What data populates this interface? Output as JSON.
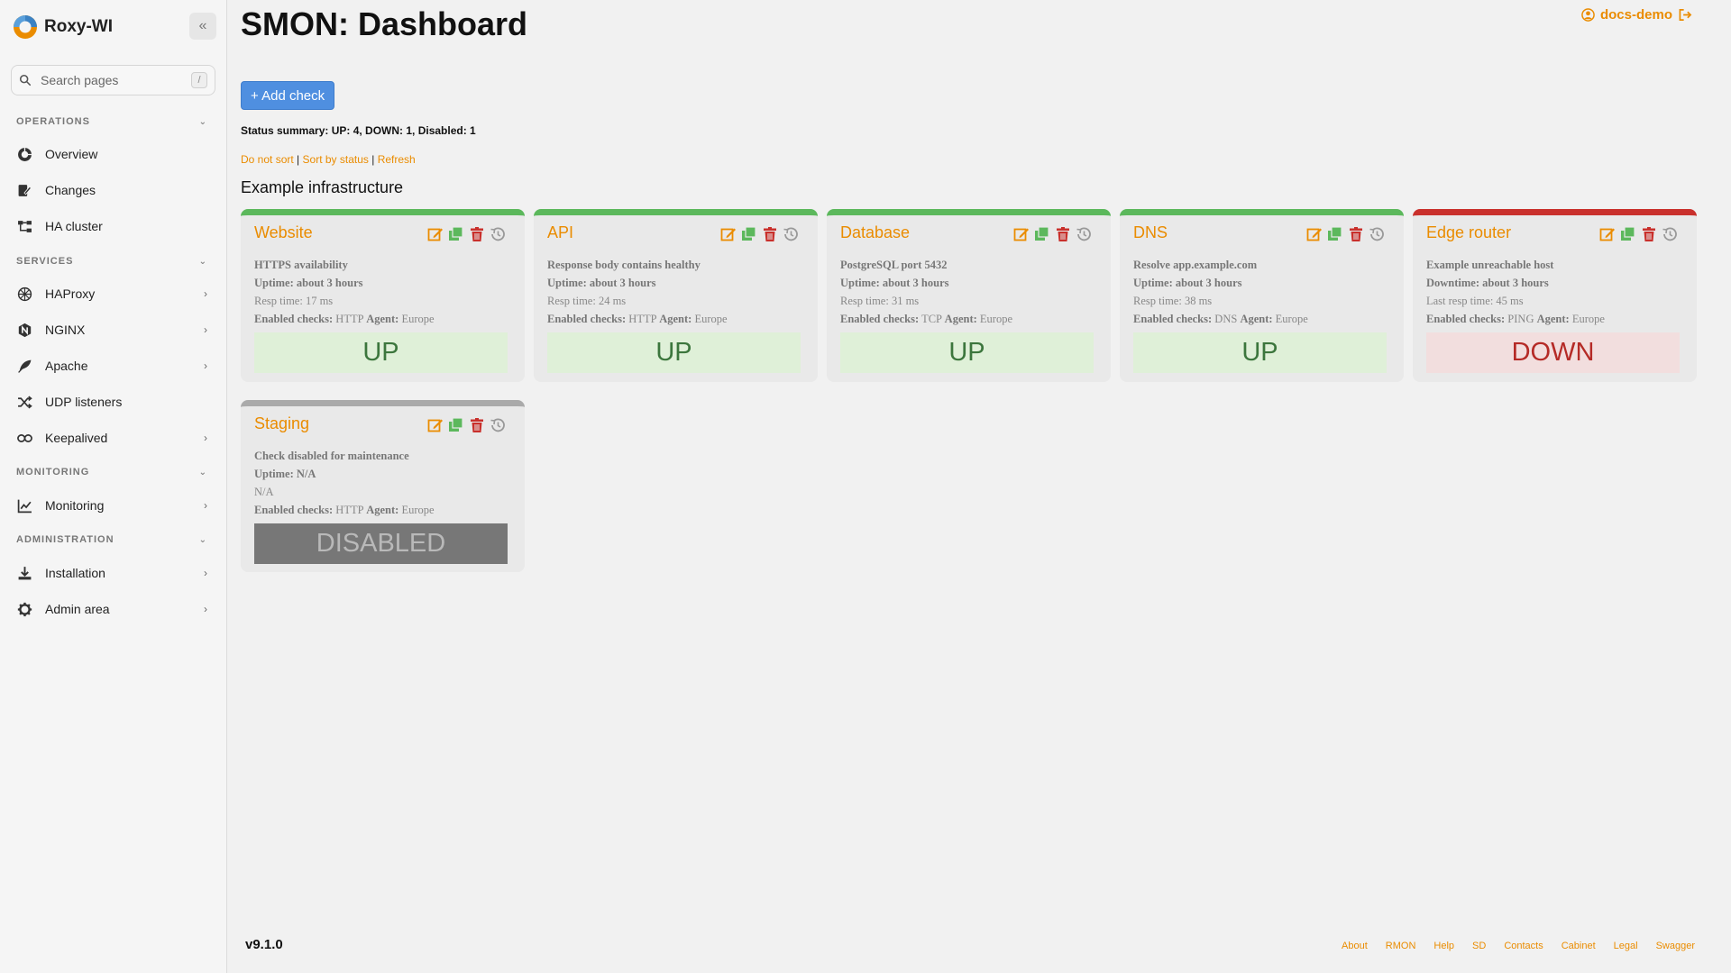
{
  "sidebar": {
    "brand": "Roxy-WI",
    "search_placeholder": "Search pages",
    "search_shortcut": "/",
    "sections": {
      "operations": "OPERATIONS",
      "services": "SERVICES",
      "monitoring": "MONITORING",
      "administration": "ADMINISTRATION"
    },
    "items": {
      "overview": "Overview",
      "changes": "Changes",
      "ha_cluster": "HA cluster",
      "haproxy": "HAProxy",
      "nginx": "NGINX",
      "apache": "Apache",
      "udp": "UDP listeners",
      "keepalived": "Keepalived",
      "monitoring": "Monitoring",
      "installation": "Installation",
      "admin_area": "Admin area"
    }
  },
  "header": {
    "title": "SMON: Dashboard",
    "user": "docs-demo"
  },
  "toolbar": {
    "add_check": "+ Add check",
    "summary": "Status summary: UP: 4, DOWN: 1, Disabled: 1",
    "sort_none": "Do not sort",
    "sort_status": "Sort by status",
    "refresh": "Refresh",
    "separator": "|"
  },
  "group": {
    "title": "Example infrastructure"
  },
  "labels": {
    "enabled_checks": "Enabled checks:",
    "agent": "Agent:"
  },
  "checks": [
    {
      "name": "Website",
      "desc": "HTTPS availability",
      "uptime": "Uptime: about 3 hours",
      "resp": "Resp time: 17 ms",
      "check": "HTTP",
      "agent": "Europe",
      "status": "UP"
    },
    {
      "name": "API",
      "desc": "Response body contains healthy",
      "uptime": "Uptime: about 3 hours",
      "resp": "Resp time: 24 ms",
      "check": "HTTP",
      "agent": "Europe",
      "status": "UP"
    },
    {
      "name": "Database",
      "desc": "PostgreSQL port 5432",
      "uptime": "Uptime: about 3 hours",
      "resp": "Resp time: 31 ms",
      "check": "TCP",
      "agent": "Europe",
      "status": "UP"
    },
    {
      "name": "DNS",
      "desc": "Resolve app.example.com",
      "uptime": "Uptime: about 3 hours",
      "resp": "Resp time: 38 ms",
      "check": "DNS",
      "agent": "Europe",
      "status": "UP"
    },
    {
      "name": "Edge router",
      "desc": "Example unreachable host",
      "uptime": "Downtime: about 3 hours",
      "resp": "Last resp time: 45 ms",
      "check": "PING",
      "agent": "Europe",
      "status": "DOWN"
    },
    {
      "name": "Staging",
      "desc": "Check disabled for maintenance",
      "uptime": "Uptime: N/A",
      "resp": "N/A",
      "check": "HTTP",
      "agent": "Europe",
      "status": "DISABLED"
    }
  ],
  "colors": {
    "accent": "#ea8c00",
    "up_border": "#5cb85c",
    "down_border": "#c9302c",
    "disabled_border": "#aaaaaa",
    "primary_button": "#4f8fe0"
  },
  "footer": {
    "version": "v9.1.0",
    "links": [
      "About",
      "RMON",
      "Help",
      "SD",
      "Contacts",
      "Cabinet",
      "Legal",
      "Swagger"
    ]
  }
}
